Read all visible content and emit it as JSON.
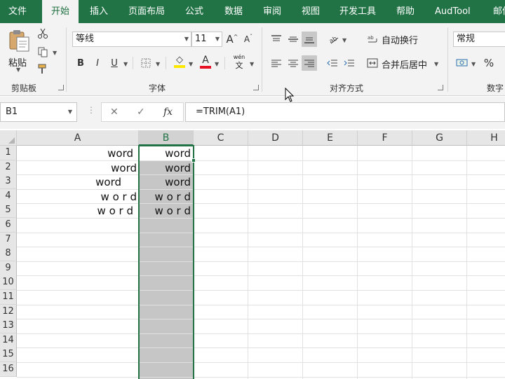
{
  "ribbon_tabs": [
    "文件",
    "开始",
    "插入",
    "页面布局",
    "公式",
    "数据",
    "审阅",
    "视图",
    "开发工具",
    "帮助",
    "AudTool",
    "邮件"
  ],
  "active_tab_index": 1,
  "clipboard": {
    "paste_label": "粘贴",
    "group_label": "剪贴板"
  },
  "font": {
    "name": "等线",
    "size": "11",
    "group_label": "字体",
    "grow_glyph": "A",
    "shrink_glyph": "A",
    "bold": "B",
    "italic": "I",
    "underline": "U",
    "fill_glyph": "◇",
    "font_color_glyph": "A",
    "phonetic_top": "wén",
    "phonetic_bottom": "文"
  },
  "alignment": {
    "wrap_text": "自动换行",
    "merge_center": "合并后居中",
    "group_label": "对齐方式"
  },
  "number": {
    "format": "常规",
    "percent": "%",
    "group_label": "数字"
  },
  "colors": {
    "accent": "#217346",
    "selection_fill": "#c6c6c6",
    "fill_color_bar": "#ffe800",
    "font_color_bar": "#e81123"
  },
  "formula_bar": {
    "name_box": "B1",
    "fx": "fx",
    "cancel": "✕",
    "enter": "✓",
    "formula": "=TRIM(A1)"
  },
  "grid": {
    "columns": [
      "A",
      "B",
      "C",
      "D",
      "E",
      "F",
      "G",
      "H"
    ],
    "selected_column": "B",
    "rows": [
      "1",
      "2",
      "3",
      "4",
      "5",
      "6",
      "7",
      "8",
      "9",
      "10",
      "11",
      "12",
      "13",
      "14",
      "15",
      "16"
    ],
    "cells": {
      "A1": "word",
      "A2": "word",
      "A3": "word",
      "A4": "w o r d",
      "A5": "w o r d",
      "B1": "word",
      "B2": "word",
      "B3": "word",
      "B4": "w o r d",
      "B5": "w o r d"
    }
  }
}
